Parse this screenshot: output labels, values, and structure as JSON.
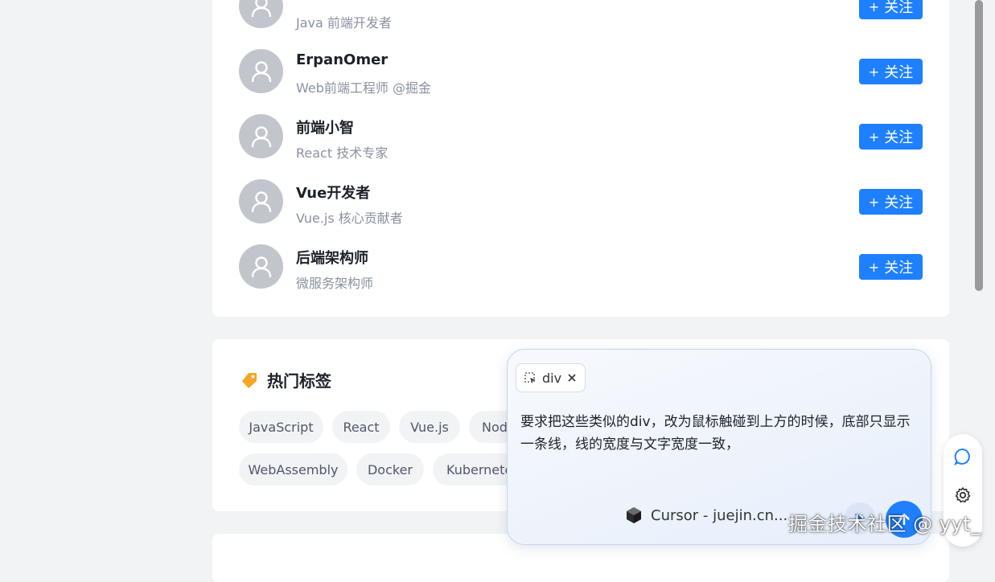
{
  "follow_list": {
    "users": [
      {
        "name": "",
        "desc": "Java 前端开发者",
        "button": "关注"
      },
      {
        "name": "ErpanOmer",
        "desc": "Web前端工程师 @掘金",
        "button": "关注"
      },
      {
        "name": "前端小智",
        "desc": "React 技术专家",
        "button": "关注"
      },
      {
        "name": "Vue开发者",
        "desc": "Vue.js 核心贡献者",
        "button": "关注"
      },
      {
        "name": "后端架构师",
        "desc": "微服务架构师",
        "button": "关注"
      }
    ],
    "plus_symbol": "+"
  },
  "tags_section": {
    "title": "热门标签",
    "tags": [
      "JavaScript",
      "React",
      "Vue.js",
      "Nod",
      "WebAssembly",
      "Docker",
      "Kubernete"
    ]
  },
  "composer": {
    "context_chip": "div",
    "prompt": "要求把这些类似的div，改为鼠标触碰到上方的时候，底部只显示一条线，线的宽度与文字宽度一致，",
    "source": "Cursor - juejin.cn..."
  },
  "watermark": "掘金技术社区 @ yyt_",
  "icons": {
    "avatar": "user-avatar-icon",
    "tag": "tag-icon",
    "chat": "chat-bubble-icon",
    "settings": "gear-icon",
    "send": "arrow-up-icon",
    "select": "select-element-icon",
    "close": "close-icon",
    "app": "cursor-app-icon"
  },
  "colors": {
    "accent": "#1e80ff",
    "tag_icon": "#f5a623"
  }
}
